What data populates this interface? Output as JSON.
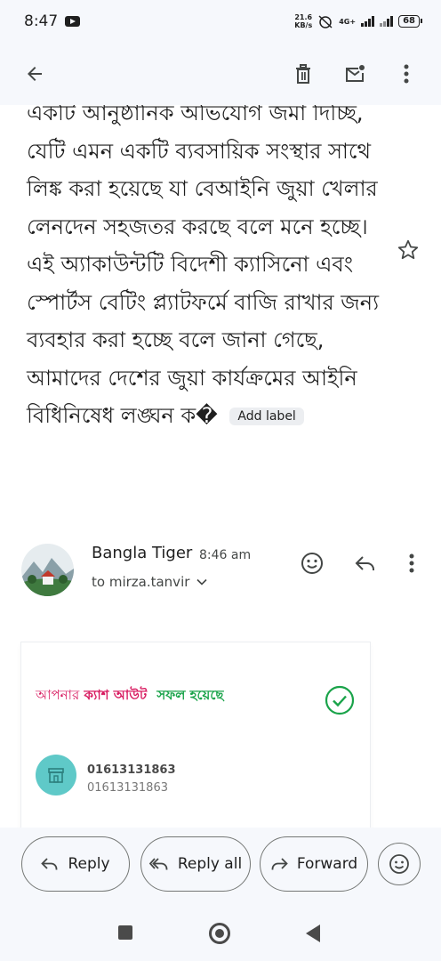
{
  "status_bar": {
    "time": "8:47",
    "net_speed_value": "21.6",
    "net_speed_unit": "KB/s",
    "network_type": "4G+",
    "battery": "68"
  },
  "toolbar": {
    "back_icon": "arrow-left-icon",
    "delete_icon": "trash-icon",
    "mark_unread_icon": "mail-unread-icon",
    "more_icon": "more-vert-icon"
  },
  "email": {
    "body_text": "একটি আনুষ্ঠানিক অভিযোগ জমা দিচ্ছি, যেটি এমন একটি ব্যবসায়িক সংস্থার সাথে লিঙ্ক করা হয়েছে যা বেআইনি জুয়া খেলার লেনদেন সহজতর করছে বলে মনে হচ্ছে। এই অ্যাকাউন্টটি বিদেশী ক্যাসিনো এবং স্পোর্টস বেটিং প্ল্যাটফর্মে বাজি রাখার জন্য ব্যবহার করা হচ্ছে বলে জানা গেছে, আমাদের দেশের জুয়া কার্যক্রমের আইনি বিধিনিষেধ লঙ্ঘন ক�",
    "add_label": "Add label"
  },
  "sender": {
    "name": "Bangla Tiger",
    "time": "8:46 am",
    "to": "to mirza.tanvir"
  },
  "card": {
    "cash_prefix": "আপনার",
    "cash_middle": "ক্যাশ আউট",
    "cash_suffix": "সফল হয়েছে",
    "number_primary": "01613131863",
    "number_secondary": "01613131863"
  },
  "actions": {
    "reply": "Reply",
    "reply_all": "Reply all",
    "forward": "Forward"
  },
  "colors": {
    "pink": "#d81b60",
    "green": "#1aa34a",
    "teal": "#5fc9c8"
  }
}
